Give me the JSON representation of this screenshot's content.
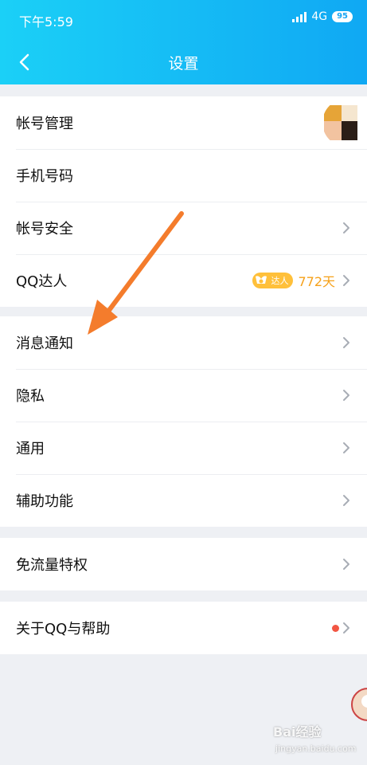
{
  "status_bar": {
    "time": "下午5:59",
    "network": "4G",
    "battery": "95"
  },
  "header": {
    "title": "设置"
  },
  "groups": [
    {
      "items": [
        {
          "label": "帐号管理"
        },
        {
          "label": "手机号码"
        },
        {
          "label": "帐号安全"
        },
        {
          "label": "QQ达人",
          "badge_text": "达人",
          "days": "772天"
        }
      ]
    },
    {
      "items": [
        {
          "label": "消息通知"
        },
        {
          "label": "隐私"
        },
        {
          "label": "通用"
        },
        {
          "label": "辅助功能"
        }
      ]
    },
    {
      "items": [
        {
          "label": "免流量特权"
        }
      ]
    },
    {
      "items": [
        {
          "label": "关于QQ与帮助"
        }
      ]
    }
  ],
  "watermark": {
    "text": "Bai经验",
    "sub": "jingyan.baidu.com"
  },
  "colors": {
    "header": "#10a8f3",
    "annotation_arrow": "#f47c2c",
    "badge": "#ffc03a",
    "red_dot": "#f25643"
  }
}
